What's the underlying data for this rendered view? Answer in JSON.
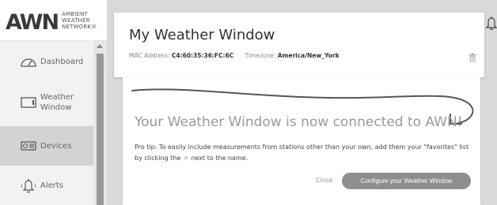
{
  "logo": {
    "mark": "AWN",
    "line1": "AMBIENT",
    "line2": "WEATHER",
    "line3": "NETWORK®"
  },
  "sidebar": {
    "items": [
      {
        "label": "Dashboard",
        "icon": "gauge-icon",
        "active": false
      },
      {
        "label": "Weather Window",
        "icon": "monitor-icon",
        "active": false
      },
      {
        "label": "Devices",
        "icon": "device-icon",
        "active": true
      },
      {
        "label": "Alerts",
        "icon": "bell-icon",
        "active": false
      }
    ]
  },
  "header": {
    "title": "My Weather Window",
    "mac_label": "MAC Address:",
    "mac_value": "C4:60:35:36:FC:6C",
    "tz_label": "Timezone:",
    "tz_value": "America/New_York"
  },
  "main": {
    "connected_text": "Your Weather Window is now connected to AWN!",
    "tip_before_star": "Pro tip: To easily include measurements from stations other than your own, add them your \"favorites\" list by clicking the",
    "tip_star": "★",
    "tip_after_star": "next to the name.",
    "close_label": "Close",
    "configure_label": "Configure your Weather Window"
  },
  "colors": {
    "background": "#d9d9d9",
    "active_nav": "#d3d3d3",
    "button": "#8e8e8e"
  }
}
